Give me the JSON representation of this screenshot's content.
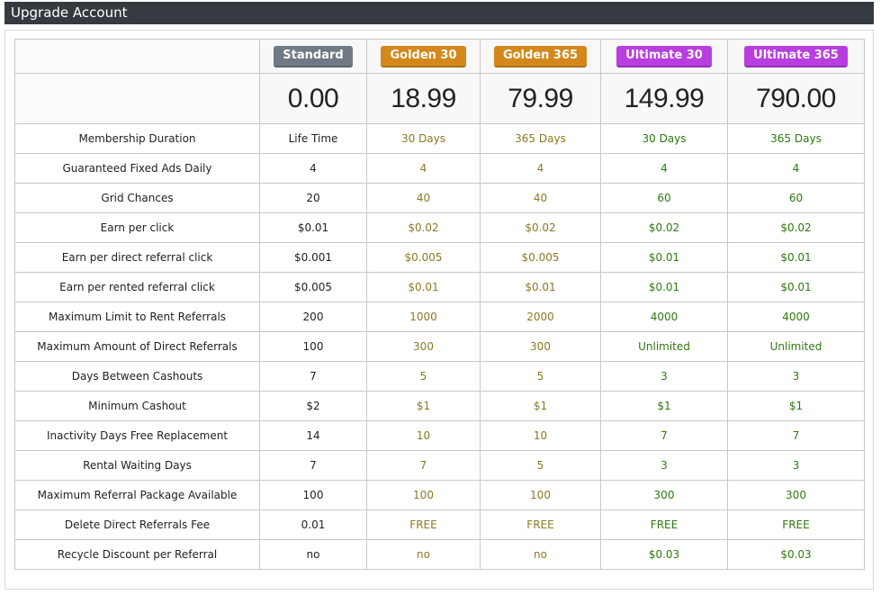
{
  "title": "Upgrade Account",
  "colors": {
    "titlebar_bg": "#343a40",
    "standard_badge": "#707a85",
    "golden_badge": "#d4881c",
    "ultimate_badge": "#b83ee0",
    "golden_text": "#8a7a22",
    "ultimate_text": "#2d7a0e"
  },
  "plans": [
    {
      "name": "Standard",
      "price": "0.00",
      "tier": "std"
    },
    {
      "name": "Golden 30",
      "price": "18.99",
      "tier": "gold"
    },
    {
      "name": "Golden 365",
      "price": "79.99",
      "tier": "gold"
    },
    {
      "name": "Ultimate 30",
      "price": "149.99",
      "tier": "ult"
    },
    {
      "name": "Ultimate 365",
      "price": "790.00",
      "tier": "ult"
    }
  ],
  "rows": [
    {
      "label": "Membership Duration",
      "values": [
        "Life Time",
        "30 Days",
        "365 Days",
        "30 Days",
        "365 Days"
      ]
    },
    {
      "label": "Guaranteed Fixed Ads Daily",
      "values": [
        "4",
        "4",
        "4",
        "4",
        "4"
      ]
    },
    {
      "label": "Grid Chances",
      "values": [
        "20",
        "40",
        "40",
        "60",
        "60"
      ]
    },
    {
      "label": "Earn per click",
      "values": [
        "$0.01",
        "$0.02",
        "$0.02",
        "$0.02",
        "$0.02"
      ]
    },
    {
      "label": "Earn per direct referral click",
      "values": [
        "$0.001",
        "$0.005",
        "$0.005",
        "$0.01",
        "$0.01"
      ]
    },
    {
      "label": "Earn per rented referral click",
      "values": [
        "$0.005",
        "$0.01",
        "$0.01",
        "$0.01",
        "$0.01"
      ]
    },
    {
      "label": "Maximum Limit to Rent Referrals",
      "values": [
        "200",
        "1000",
        "2000",
        "4000",
        "4000"
      ]
    },
    {
      "label": "Maximum Amount of Direct Referrals",
      "values": [
        "100",
        "300",
        "300",
        "Unlimited",
        "Unlimited"
      ]
    },
    {
      "label": "Days Between Cashouts",
      "values": [
        "7",
        "5",
        "5",
        "3",
        "3"
      ]
    },
    {
      "label": "Minimum Cashout",
      "values": [
        "$2",
        "$1",
        "$1",
        "$1",
        "$1"
      ]
    },
    {
      "label": "Inactivity Days Free Replacement",
      "values": [
        "14",
        "10",
        "10",
        "7",
        "7"
      ]
    },
    {
      "label": "Rental Waiting Days",
      "values": [
        "7",
        "7",
        "5",
        "3",
        "3"
      ]
    },
    {
      "label": "Maximum Referral Package Available",
      "values": [
        "100",
        "100",
        "100",
        "300",
        "300"
      ]
    },
    {
      "label": "Delete Direct Referrals Fee",
      "values": [
        "0.01",
        "FREE",
        "FREE",
        "FREE",
        "FREE"
      ]
    },
    {
      "label": "Recycle Discount per Referral",
      "values": [
        "no",
        "no",
        "no",
        "$0.03",
        "$0.03"
      ]
    }
  ]
}
